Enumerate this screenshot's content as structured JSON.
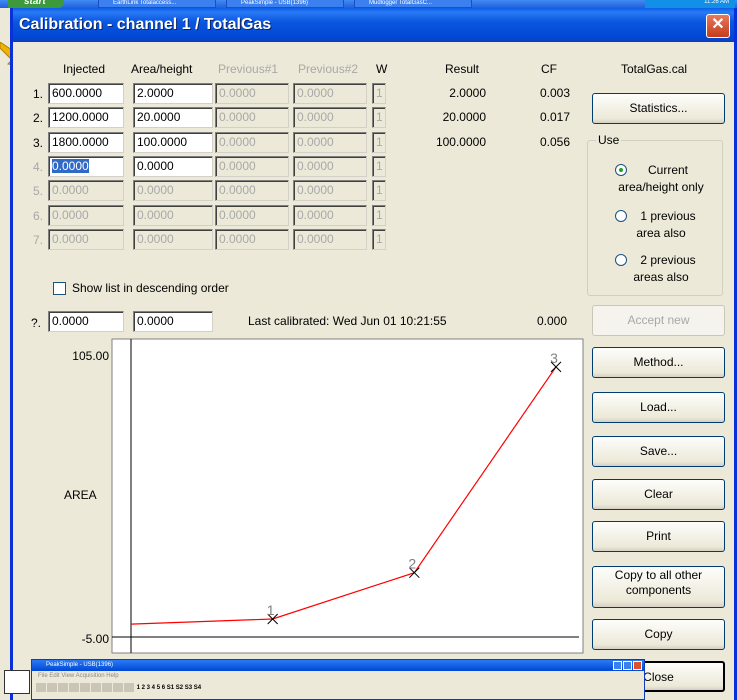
{
  "taskbar": {
    "start": "start",
    "items": [
      "EarthLink Totalaccess...",
      "PeakSimple - USB(1396)",
      "Mudlogger TotalGasC..."
    ],
    "clock": "11:26 AM"
  },
  "window": {
    "title": "Calibration - channel 1 / TotalGas",
    "close": "✕"
  },
  "table": {
    "headers": {
      "injected": "Injected",
      "area": "Area/height",
      "prev1": "Previous#1",
      "prev2": "Previous#2",
      "w": "W",
      "result": "Result",
      "cf": "CF"
    },
    "rows": [
      {
        "num": "1.",
        "injected": "600.0000",
        "area": "2.0000",
        "prev1": "0.0000",
        "prev2": "0.0000",
        "w": "1",
        "result": "2.0000",
        "cf": "0.003"
      },
      {
        "num": "2.",
        "injected": "1200.0000",
        "area": "20.0000",
        "prev1": "0.0000",
        "prev2": "0.0000",
        "w": "1",
        "result": "20.0000",
        "cf": "0.017"
      },
      {
        "num": "3.",
        "injected": "1800.0000",
        "area": "100.0000",
        "prev1": "0.0000",
        "prev2": "0.0000",
        "w": "1",
        "result": "100.0000",
        "cf": "0.056"
      },
      {
        "num": "4.",
        "injected": "0.0000",
        "area": "0.0000",
        "prev1": "0.0000",
        "prev2": "0.0000",
        "w": "1",
        "result": "",
        "cf": ""
      },
      {
        "num": "5.",
        "injected": "0.0000",
        "area": "0.0000",
        "prev1": "0.0000",
        "prev2": "0.0000",
        "w": "1",
        "result": "",
        "cf": ""
      },
      {
        "num": "6.",
        "injected": "0.0000",
        "area": "0.0000",
        "prev1": "0.0000",
        "prev2": "0.0000",
        "w": "1",
        "result": "",
        "cf": ""
      },
      {
        "num": "7.",
        "injected": "0.0000",
        "area": "0.0000",
        "prev1": "0.0000",
        "prev2": "0.0000",
        "w": "1",
        "result": "",
        "cf": ""
      }
    ]
  },
  "filename": "TotalGas.cal",
  "statistics_label": "Statistics...",
  "use_group": {
    "legend": "Use",
    "options": [
      {
        "line1": "Current",
        "line2": "area/height only",
        "checked": true
      },
      {
        "line1": "1 previous",
        "line2": "area also",
        "checked": false
      },
      {
        "line1": "2 previous",
        "line2": "areas also",
        "checked": false
      }
    ]
  },
  "show_list": {
    "label": "Show list in descending order",
    "checked": false
  },
  "query_row": {
    "num": "?.",
    "injected": "0.0000",
    "area": "0.0000",
    "last_calibrated": "Last calibrated:  Wed Jun 01 10:21:55",
    "cf": "0.000"
  },
  "buttons": {
    "accept_new": "Accept new",
    "method": "Method...",
    "load": "Load...",
    "save": "Save...",
    "clear": "Clear",
    "print": "Print",
    "copy_all_1": "Copy to all other",
    "copy_all_2": "components",
    "copy": "Copy",
    "close": "Close"
  },
  "chart_data": {
    "type": "line",
    "ylabel": "AREA",
    "xlabel": "",
    "title": "",
    "ylim": [
      -5.0,
      105.0
    ],
    "ytick_labels": [
      "105.00",
      "-5.00"
    ],
    "x": [
      0,
      600,
      1200,
      1800
    ],
    "values": [
      0,
      2,
      20,
      100
    ],
    "point_labels": [
      "",
      "1",
      "2",
      "3"
    ],
    "line_color": "#ff0000",
    "marker": "x"
  },
  "peaksimple": {
    "title": "PeakSimple - USB(1396)",
    "menu": "File   Edit   View   Acquisition   Help",
    "toolbar_text": "1  2  3  4  5  6     S1 S2 S3 S4"
  },
  "colors": {
    "title_bar": "#0148d4",
    "selection": "#316ac5",
    "line": "#ff0000"
  }
}
